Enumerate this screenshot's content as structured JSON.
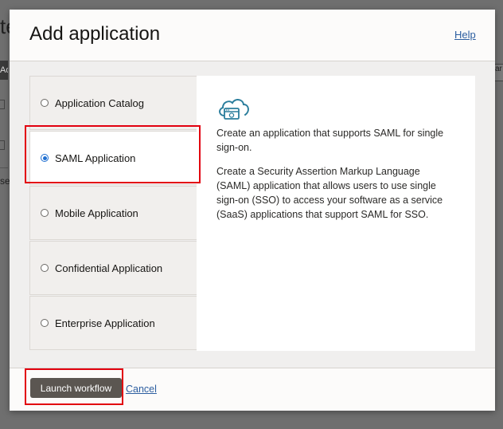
{
  "background": {
    "title_fragment": "te",
    "button_fragment": "Ad",
    "side_fragment": "ar",
    "text_fragment": "se"
  },
  "modal": {
    "title": "Add application",
    "help_label": "Help"
  },
  "options": [
    {
      "label": "Application Catalog",
      "selected": false
    },
    {
      "label": "SAML Application",
      "selected": true
    },
    {
      "label": "Mobile Application",
      "selected": false
    },
    {
      "label": "Confidential Application",
      "selected": false
    },
    {
      "label": "Enterprise Application",
      "selected": false
    }
  ],
  "detail": {
    "icon": "cloud-app-icon",
    "summary": "Create an application that supports SAML for single sign-on.",
    "description": "Create a Security Assertion Markup Language (SAML) application that allows users to use single sign-on (SSO) to access your software as a service (SaaS) applications that support SAML for SSO."
  },
  "footer": {
    "launch_label": "Launch workflow",
    "cancel_label": "Cancel"
  },
  "colors": {
    "accent": "#1f6fd1",
    "highlight": "#e2000f",
    "primary_button": "#5b5651",
    "link": "#2c5ea0"
  }
}
